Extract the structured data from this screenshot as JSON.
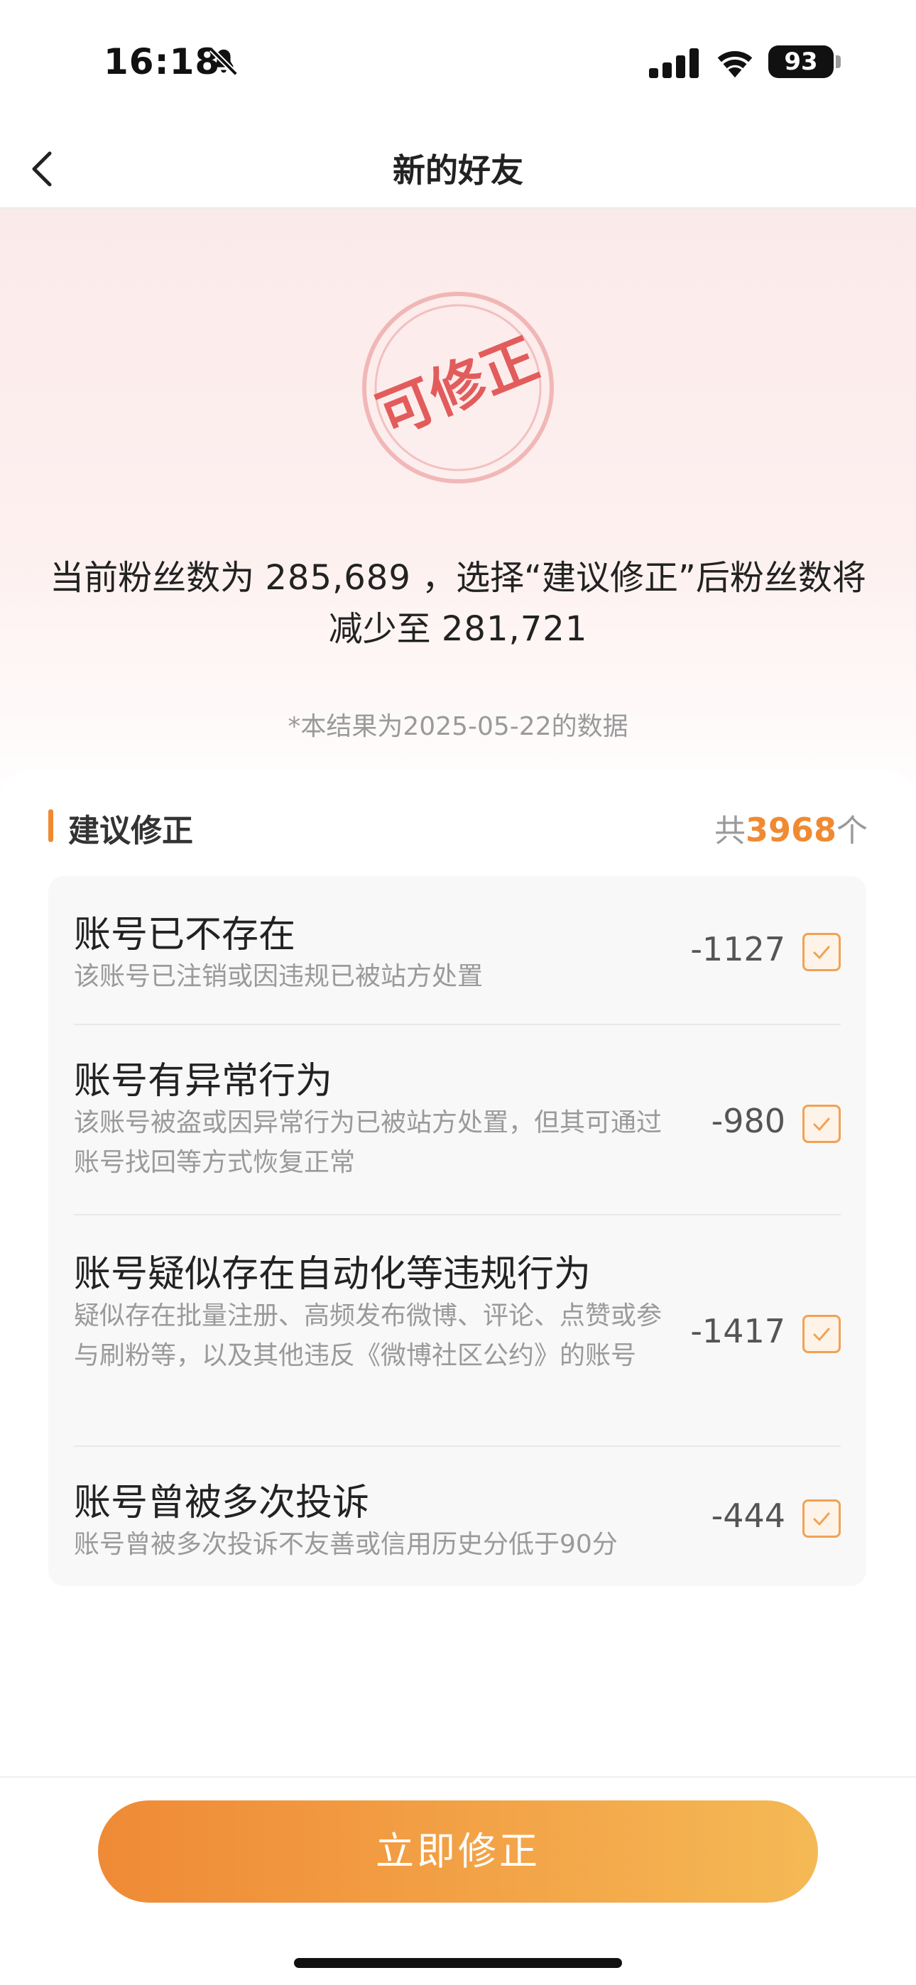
{
  "status_bar": {
    "time": "16:18",
    "battery": "93",
    "icons": [
      "bell-off-icon",
      "signal-icon",
      "wifi-icon",
      "battery-icon"
    ]
  },
  "nav": {
    "title": "新的好友",
    "back_icon": "chevron-left-icon"
  },
  "hero": {
    "stamp_text": "可修正",
    "summary_prefix": "当前粉丝数为",
    "current_fans": "285,689",
    "summary_middle": "，选择“建议修正”后粉丝数将减少至",
    "result_fans": "281,721",
    "data_note": "*本结果为2025-05-22的数据"
  },
  "section": {
    "title": "建议修正",
    "total_prefix": "共",
    "total_count": "3968",
    "total_suffix": "个"
  },
  "items": [
    {
      "title": "账号已不存在",
      "desc": "该账号已注销或因违规已被站方处置",
      "value": "-1127",
      "checked": true
    },
    {
      "title": "账号有异常行为",
      "desc": "该账号被盗或因异常行为已被站方处置，但其可通过账号找回等方式恢复正常",
      "value": "-980",
      "checked": true
    },
    {
      "title": "账号疑似存在自动化等违规行为",
      "desc": "疑似存在批量注册、高频发布微博、评论、点赞或参与刷粉等，以及其他违反《微博社区公约》的账号",
      "value": "-1417",
      "checked": true
    },
    {
      "title": "账号曾被多次投诉",
      "desc": "账号曾被多次投诉不友善或信用历史分低于90分",
      "value": "-444",
      "checked": true
    }
  ],
  "action": {
    "button_label": "立即修正"
  },
  "colors": {
    "accent": "#f08a32",
    "checkbox_border": "#f0a255",
    "stamp": "#e25c5c"
  }
}
